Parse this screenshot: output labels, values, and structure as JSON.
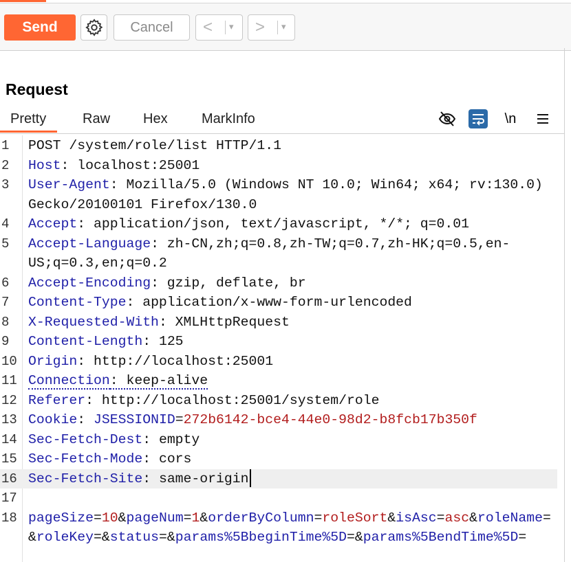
{
  "toolbar": {
    "send_label": "Send",
    "cancel_label": "Cancel",
    "prev_label": "<",
    "next_label": ">",
    "dropdown_glyph": "▾"
  },
  "panel": {
    "title": "Request",
    "tabs": [
      "Pretty",
      "Raw",
      "Hex",
      "MarkInfo"
    ],
    "active_tab": "Pretty",
    "newline_toggle": "\\n",
    "accent": "#ff6633"
  },
  "request": {
    "lines": [
      {
        "n": "1",
        "segs": [
          [
            "v",
            "POST /system/role/list HTTP/1.1"
          ]
        ]
      },
      {
        "n": "2",
        "segs": [
          [
            "k",
            "Host"
          ],
          [
            "v",
            ": localhost:25001"
          ]
        ]
      },
      {
        "n": "3",
        "segs": [
          [
            "k",
            "User-Agent"
          ],
          [
            "v",
            ": Mozilla/5.0 (Windows NT 10.0; Win64; x64; rv:130.0) Gecko/20100101 Firefox/130.0"
          ]
        ]
      },
      {
        "n": "4",
        "segs": [
          [
            "k",
            "Accept"
          ],
          [
            "v",
            ": application/json, text/javascript, */*; q=0.01"
          ]
        ]
      },
      {
        "n": "5",
        "segs": [
          [
            "k",
            "Accept-Language"
          ],
          [
            "v",
            ": zh-CN,zh;q=0.8,zh-TW;q=0.7,zh-HK;q=0.5,en-US;q=0.3,en;q=0.2"
          ]
        ]
      },
      {
        "n": "6",
        "segs": [
          [
            "k",
            "Accept-Encoding"
          ],
          [
            "v",
            ": gzip, deflate, br"
          ]
        ]
      },
      {
        "n": "7",
        "segs": [
          [
            "k",
            "Content-Type"
          ],
          [
            "v",
            ": application/x-www-form-urlencoded"
          ]
        ]
      },
      {
        "n": "8",
        "segs": [
          [
            "k",
            "X-Requested-With"
          ],
          [
            "v",
            ": XMLHttpRequest"
          ]
        ]
      },
      {
        "n": "9",
        "segs": [
          [
            "k",
            "Content-Length"
          ],
          [
            "v",
            ": 125"
          ]
        ]
      },
      {
        "n": "10",
        "segs": [
          [
            "k",
            "Origin"
          ],
          [
            "v",
            ": http://localhost:25001"
          ]
        ]
      },
      {
        "n": "11",
        "segs": [
          [
            "kd",
            "Connection"
          ],
          [
            "vd",
            ": keep-alive"
          ]
        ]
      },
      {
        "n": "12",
        "segs": [
          [
            "k",
            "Referer"
          ],
          [
            "v",
            ": http://localhost:25001/system/role"
          ]
        ]
      },
      {
        "n": "13",
        "segs": [
          [
            "k",
            "Cookie"
          ],
          [
            "v",
            ": "
          ],
          [
            "k",
            "JSESSIONID"
          ],
          [
            "p",
            "="
          ],
          [
            "r",
            "272b6142-bce4-44e0-98d2-b8fcb17b350f"
          ]
        ]
      },
      {
        "n": "14",
        "segs": [
          [
            "k",
            "Sec-Fetch-Dest"
          ],
          [
            "v",
            ": empty"
          ]
        ]
      },
      {
        "n": "15",
        "segs": [
          [
            "k",
            "Sec-Fetch-Mode"
          ],
          [
            "v",
            ": cors"
          ]
        ]
      },
      {
        "n": "16",
        "current": true,
        "segs": [
          [
            "k",
            "Sec-Fetch-Site"
          ],
          [
            "v",
            ": same-origin"
          ]
        ]
      },
      {
        "n": "17",
        "segs": []
      },
      {
        "n": "18",
        "body": true,
        "segs": [
          [
            "k",
            "pageSize"
          ],
          [
            "p",
            "="
          ],
          [
            "r",
            "10"
          ],
          [
            "p",
            "&"
          ],
          [
            "k",
            "pageNum"
          ],
          [
            "p",
            "="
          ],
          [
            "r",
            "1"
          ],
          [
            "p",
            "&"
          ],
          [
            "k",
            "orderByColumn"
          ],
          [
            "p",
            "="
          ],
          [
            "r",
            "roleSort"
          ],
          [
            "p",
            "&"
          ],
          [
            "k",
            "isAsc"
          ],
          [
            "p",
            "="
          ],
          [
            "r",
            "asc"
          ],
          [
            "p",
            "&"
          ],
          [
            "k",
            "roleName"
          ],
          [
            "p",
            "=&"
          ],
          [
            "k",
            "roleKey"
          ],
          [
            "p",
            "=&"
          ],
          [
            "k",
            "status"
          ],
          [
            "p",
            "=&"
          ],
          [
            "k",
            "params%5BbeginTime%5D"
          ],
          [
            "p",
            "=&"
          ],
          [
            "k",
            "params%5BendTime%5D"
          ],
          [
            "p",
            "="
          ]
        ]
      }
    ]
  }
}
